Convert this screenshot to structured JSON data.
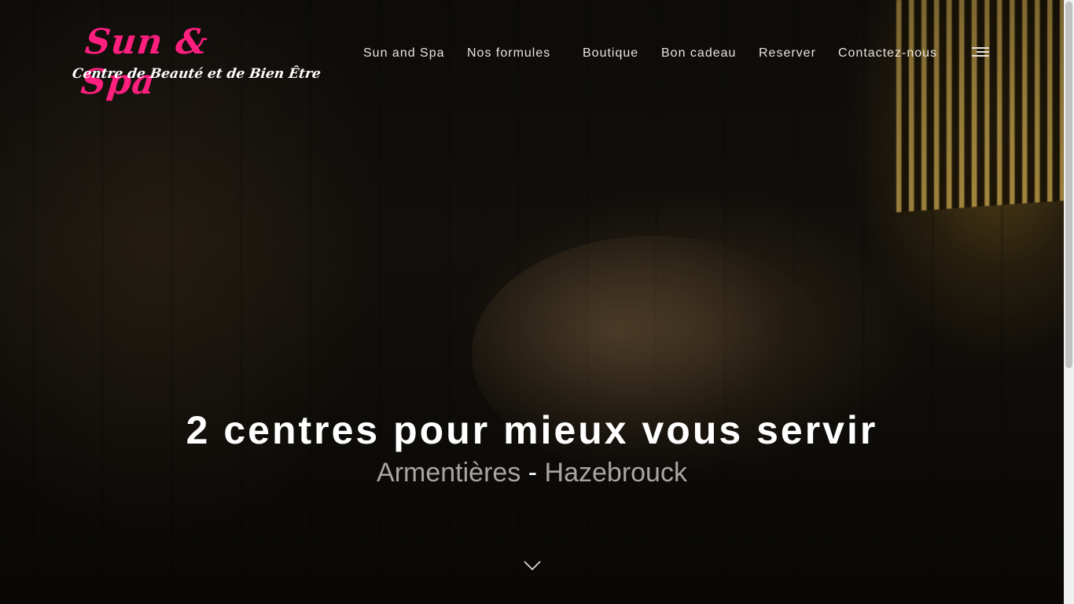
{
  "header": {
    "logo": {
      "title": "Sun & Spa",
      "subtitle": "Centre de Beauté et de Bien Être"
    },
    "nav": [
      {
        "label": "Sun and Spa"
      },
      {
        "label": "Nos formules"
      },
      {
        "label": "Boutique"
      },
      {
        "label": "Bon cadeau"
      },
      {
        "label": "Reserver"
      },
      {
        "label": "Contactez-nous"
      }
    ],
    "menu_icon": "hamburger-menu-icon"
  },
  "hero": {
    "headline": "2 centres pour mieux vous servir",
    "city_1": "Armentières",
    "separator": "-",
    "city_2": "Hazebrouck",
    "scroll_icon": "chevron-down-icon"
  },
  "colors": {
    "brand_pink": "#ff1f7f",
    "nav_text": "#e8e4dd",
    "city_text": "#a8a6a2",
    "headline_text": "#ffffff"
  }
}
